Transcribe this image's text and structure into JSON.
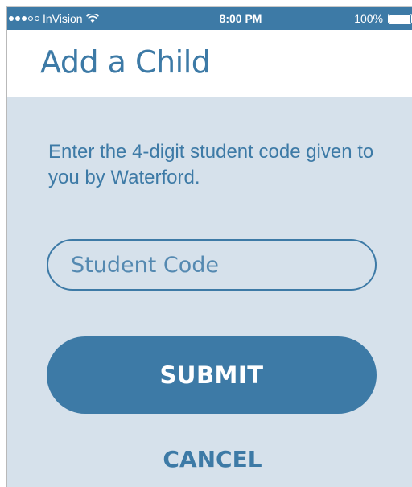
{
  "status_bar": {
    "carrier": "InVision",
    "time": "8:00 PM",
    "battery": "100%",
    "signal_bars_filled": 3,
    "signal_bars_total": 5,
    "battery_level": 1.0,
    "icons": [
      "signal-icon",
      "wifi-icon",
      "battery-icon"
    ]
  },
  "header": {
    "title": "Add a Child"
  },
  "form": {
    "instructions": "Enter the 4-digit student code given to you by Waterford.",
    "code_placeholder": "Student Code",
    "code_value": "",
    "submit_label": "SUBMIT",
    "cancel_label": "CANCEL"
  },
  "colors": {
    "brand": "#3d7aa6",
    "background": "#d6e1eb",
    "header_bg": "#ffffff"
  }
}
